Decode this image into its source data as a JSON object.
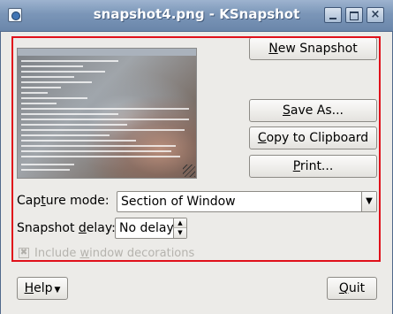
{
  "window": {
    "title": "snapshot4.png - KSnapshot",
    "icon": "ksnapshot-app-icon",
    "controls": {
      "minimize": "minimize-icon",
      "maximize": "maximize-icon",
      "close": "close-icon",
      "close_glyph": "×"
    }
  },
  "preview": {
    "description_icon": "snapshot-preview-image"
  },
  "actions": {
    "new_snapshot": {
      "pre": "",
      "key": "N",
      "post": "ew Snapshot"
    },
    "save_as": {
      "pre": "",
      "key": "S",
      "post": "ave As..."
    },
    "copy_clipboard": {
      "pre": "",
      "key": "C",
      "post": "opy to Clipboard"
    },
    "print": {
      "pre": "",
      "key": "P",
      "post": "rint..."
    }
  },
  "capture_mode": {
    "label_pre": "Cap",
    "label_key": "t",
    "label_post": "ure mode:",
    "value": "Section of Window"
  },
  "snapshot_delay": {
    "label_pre": "Snapshot ",
    "label_key": "d",
    "label_post": "elay:",
    "value": "No delay"
  },
  "include_decorations": {
    "pre": "Include ",
    "key": "w",
    "post": "indow decorations",
    "checked": true,
    "enabled": false
  },
  "footer": {
    "help": {
      "pre": "",
      "key": "H",
      "post": "elp"
    },
    "quit": {
      "pre": "",
      "key": "Q",
      "post": "uit"
    }
  },
  "colors": {
    "highlight_border": "#e0101a",
    "titlebar": "#7b96b8",
    "dialog_bg": "#ecebe8"
  }
}
